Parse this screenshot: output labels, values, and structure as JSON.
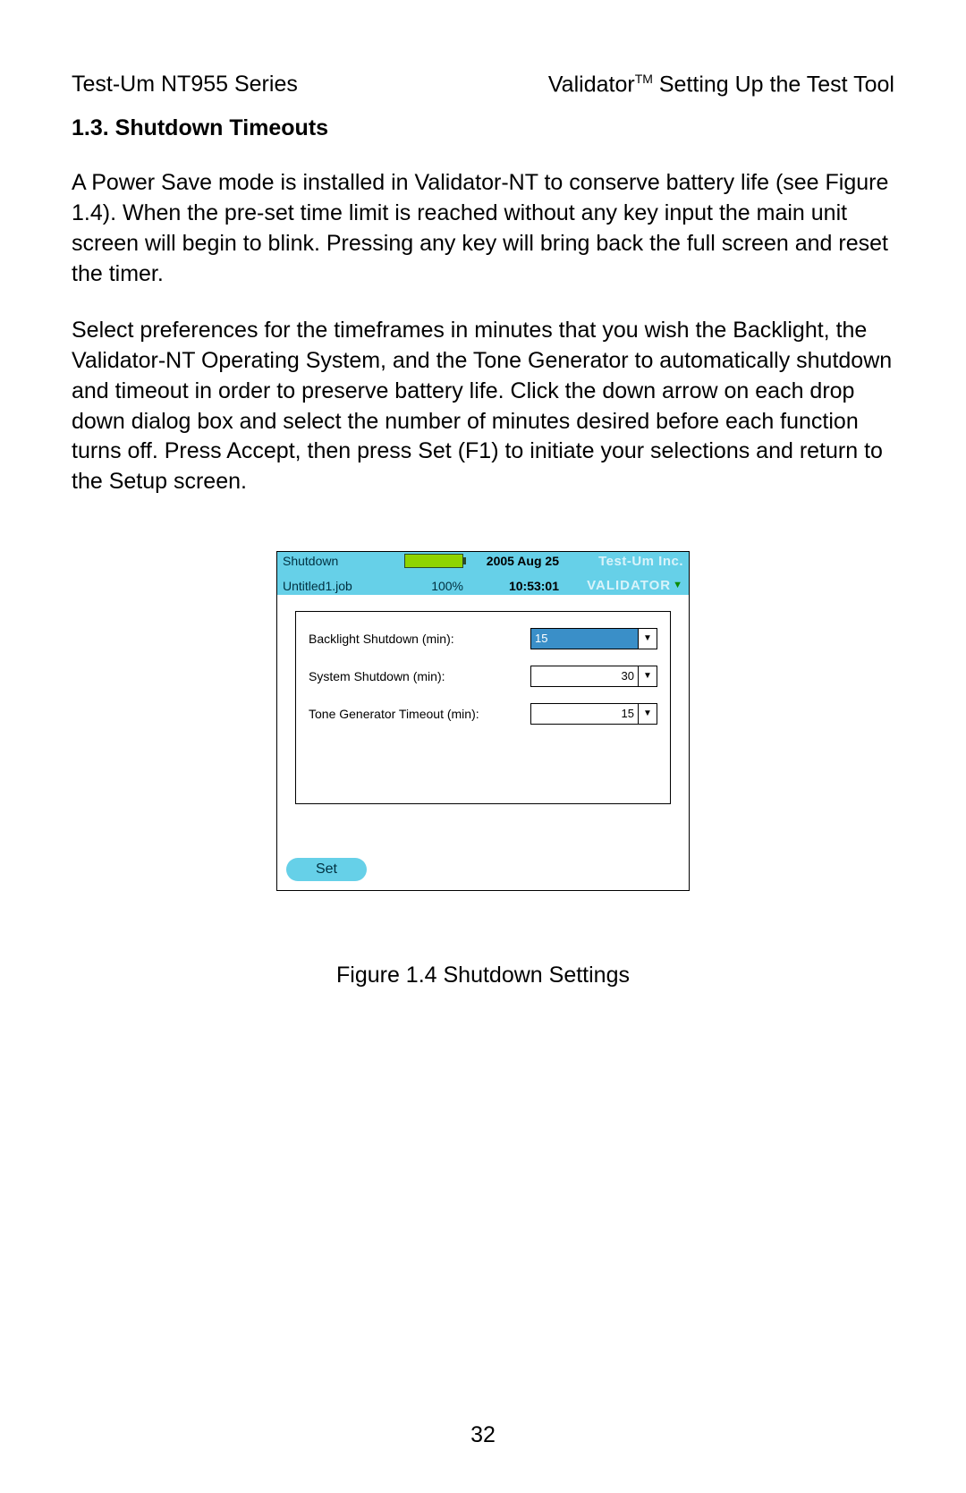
{
  "header": {
    "left": "Test-Um NT955 Series",
    "right_prefix": "Validator",
    "right_tm": "TM",
    "right_suffix": " Setting Up the Test Tool"
  },
  "section_title": "1.3. Shutdown Timeouts",
  "para1": "A Power Save mode is installed in Validator-NT to conserve battery life (see Figure 1.4).  When the pre-set time limit is reached without any key input the main unit screen will begin to blink. Pressing any key will bring back the full screen and reset the timer.",
  "para2": "Select preferences for the timeframes in minutes that you wish the Backlight, the Validator-NT Operating System, and the Tone Generator to automatically shutdown and timeout in order to preserve battery life.  Click the down arrow on each drop down dialog box and select the number of minutes desired before each function turns off.  Press Accept, then press Set (F1) to initiate your selections and return to the Setup screen.",
  "device": {
    "status": {
      "title": "Shutdown",
      "job": "Untitled1.job",
      "battery_pct": "100%",
      "date": "2005 Aug 25",
      "time": "10:53:01",
      "brand1": "Test-Um Inc.",
      "brand2": "VALIDATOR"
    },
    "rows": [
      {
        "label": "Backlight Shutdown (min):",
        "value": "15",
        "selected": true
      },
      {
        "label": "System Shutdown (min):",
        "value": "30",
        "selected": false
      },
      {
        "label": "Tone Generator Timeout (min):",
        "value": "15",
        "selected": false
      }
    ],
    "softkey": "Set"
  },
  "figure_caption": "Figure 1.4 Shutdown Settings",
  "page_number": "32"
}
